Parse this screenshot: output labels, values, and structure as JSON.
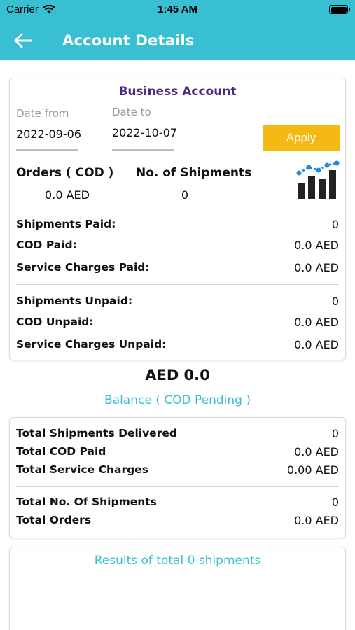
{
  "status_bar": {
    "carrier": "Carrier",
    "time": "1:45 AM"
  },
  "header": {
    "title": "Account Details"
  },
  "account": {
    "title": "Business Account",
    "date_from_label": "Date from",
    "date_from_value": "2022-09-06",
    "date_to_label": "Date to",
    "date_to_value": "2022-10-07",
    "apply_label": "Apply"
  },
  "summary": {
    "orders_label": "Orders ( COD )",
    "orders_value": "0.0 AED",
    "shipments_label": "No. of Shipments",
    "shipments_value": "0"
  },
  "paid": [
    {
      "label": "Shipments Paid:",
      "value": "0"
    },
    {
      "label": "COD Paid:",
      "value": "0.0 AED"
    },
    {
      "label": "Service Charges Paid:",
      "value": "0.0 AED"
    }
  ],
  "unpaid": [
    {
      "label": "Shipments Unpaid:",
      "value": "0"
    },
    {
      "label": "COD Unpaid:",
      "value": "0.0 AED"
    },
    {
      "label": "Service Charges Unpaid:",
      "value": "0.0 AED"
    }
  ],
  "balance": {
    "amount": "AED 0.0",
    "label": "Balance ( COD Pending )"
  },
  "totals_a": [
    {
      "label": "Total Shipments Delivered",
      "value": "0"
    },
    {
      "label": "Total COD Paid",
      "value": "0.0 AED"
    },
    {
      "label": "Total Service Charges",
      "value": "0.00 AED"
    }
  ],
  "totals_b": [
    {
      "label": "Total No. Of Shipments",
      "value": "0"
    },
    {
      "label": "Total Orders",
      "value": "0.0 AED"
    }
  ],
  "results": {
    "text": "Results of total 0 shipments"
  },
  "icons": {
    "back": "arrow-left-icon",
    "chart": "bar-line-chart-icon",
    "wifi": "wifi-icon",
    "battery": "battery-icon"
  },
  "colors": {
    "primary": "#39bfd2",
    "accent": "#f5b914",
    "account_title": "#4a2a7a"
  }
}
